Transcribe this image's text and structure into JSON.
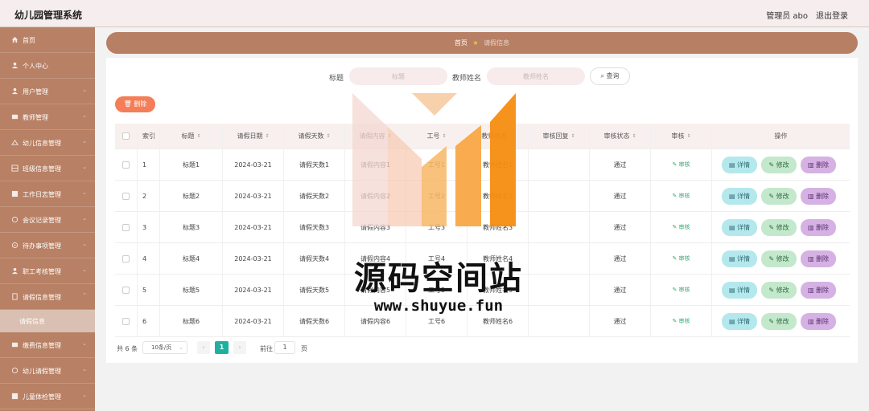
{
  "header": {
    "title": "幼儿园管理系统",
    "admin": "管理员 abo",
    "logout": "退出登录"
  },
  "sidebar": {
    "items": [
      {
        "label": "首页",
        "icon": "home-icon"
      },
      {
        "label": "个人中心",
        "icon": "user-icon"
      },
      {
        "label": "用户管理",
        "icon": "users-icon"
      },
      {
        "label": "教师管理",
        "icon": "teacher-icon"
      },
      {
        "label": "幼儿信息管理",
        "icon": "child-icon"
      },
      {
        "label": "班级信息管理",
        "icon": "class-icon"
      },
      {
        "label": "工作日志管理",
        "icon": "log-icon"
      },
      {
        "label": "会议记录管理",
        "icon": "meeting-icon"
      },
      {
        "label": "待办事项管理",
        "icon": "todo-icon"
      },
      {
        "label": "职工考核管理",
        "icon": "assess-icon"
      },
      {
        "label": "请假信息管理",
        "icon": "leave-icon"
      }
    ],
    "sub_item": {
      "label": "请假信息"
    },
    "items_after": [
      {
        "label": "缴费信息管理",
        "icon": "pay-icon"
      },
      {
        "label": "幼儿请假管理",
        "icon": "child-leave-icon"
      },
      {
        "label": "儿童体检管理",
        "icon": "health-icon"
      }
    ]
  },
  "breadcrumb": {
    "home": "首页",
    "current": "请假信息"
  },
  "search": {
    "title_label": "标题",
    "title_placeholder": "标题",
    "teacher_label": "教师姓名",
    "teacher_placeholder": "教师姓名",
    "button": "查询"
  },
  "toolbar": {
    "delete": "删除"
  },
  "table": {
    "headers": [
      "索引",
      "标题",
      "请假日期",
      "请假天数",
      "请假内容",
      "工号",
      "教师姓名",
      "审核回复",
      "审核状态",
      "审核",
      "操作"
    ],
    "rows": [
      {
        "index": "1",
        "title": "标题1",
        "date": "2024-03-21",
        "days": "请假天数1",
        "content": "请假内容1",
        "work_no": "工号1",
        "teacher": "教师姓名1",
        "reply": "",
        "status": "通过",
        "audit": "审核"
      },
      {
        "index": "2",
        "title": "标题2",
        "date": "2024-03-21",
        "days": "请假天数2",
        "content": "请假内容2",
        "work_no": "工号2",
        "teacher": "教师姓名2",
        "reply": "",
        "status": "通过",
        "audit": "审核"
      },
      {
        "index": "3",
        "title": "标题3",
        "date": "2024-03-21",
        "days": "请假天数3",
        "content": "请假内容3",
        "work_no": "工号3",
        "teacher": "教师姓名3",
        "reply": "",
        "status": "通过",
        "audit": "审核"
      },
      {
        "index": "4",
        "title": "标题4",
        "date": "2024-03-21",
        "days": "请假天数4",
        "content": "请假内容4",
        "work_no": "工号4",
        "teacher": "教师姓名4",
        "reply": "",
        "status": "通过",
        "audit": "审核"
      },
      {
        "index": "5",
        "title": "标题5",
        "date": "2024-03-21",
        "days": "请假天数5",
        "content": "请假内容5",
        "work_no": "工号5",
        "teacher": "教师姓名5",
        "reply": "",
        "status": "通过",
        "audit": "审核"
      },
      {
        "index": "6",
        "title": "标题6",
        "date": "2024-03-21",
        "days": "请假天数6",
        "content": "请假内容6",
        "work_no": "工号6",
        "teacher": "教师姓名6",
        "reply": "",
        "status": "通过",
        "audit": "审核"
      }
    ],
    "actions": {
      "detail": "详情",
      "edit": "修改",
      "delete": "删除"
    }
  },
  "pagination": {
    "total": "共 6 条",
    "page_size": "10条/页",
    "current_page": "1",
    "prev": "‹",
    "next": "›",
    "goto_label": "前往",
    "goto_value": "1",
    "page_unit": "页"
  },
  "watermark": {
    "text": "源码空间站",
    "url": "www.shuyue.fun"
  },
  "colors": {
    "sidebar": "#b77f63",
    "accent_delete": "#f47e57",
    "page_active": "#1fb19e"
  }
}
